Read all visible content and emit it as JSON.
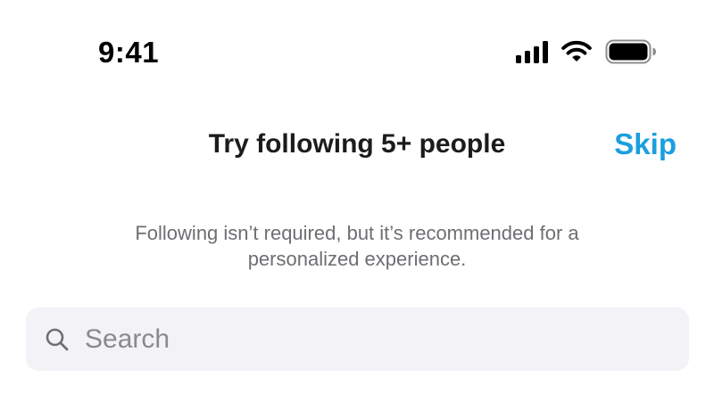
{
  "status_bar": {
    "time": "9:41",
    "icons": [
      "cellular-signal-icon",
      "wifi-icon",
      "battery-icon"
    ]
  },
  "header": {
    "title": "Try following 5+ people",
    "skip_label": "Skip"
  },
  "subtitle": "Following isn’t required, but it’s recommended for a personalized experience.",
  "search": {
    "icon": "search-icon",
    "placeholder": "Search",
    "value": ""
  },
  "colors": {
    "accent": "#1a9fe0",
    "search_background": "#f2f2f7",
    "secondary_text": "#6e6e73"
  }
}
